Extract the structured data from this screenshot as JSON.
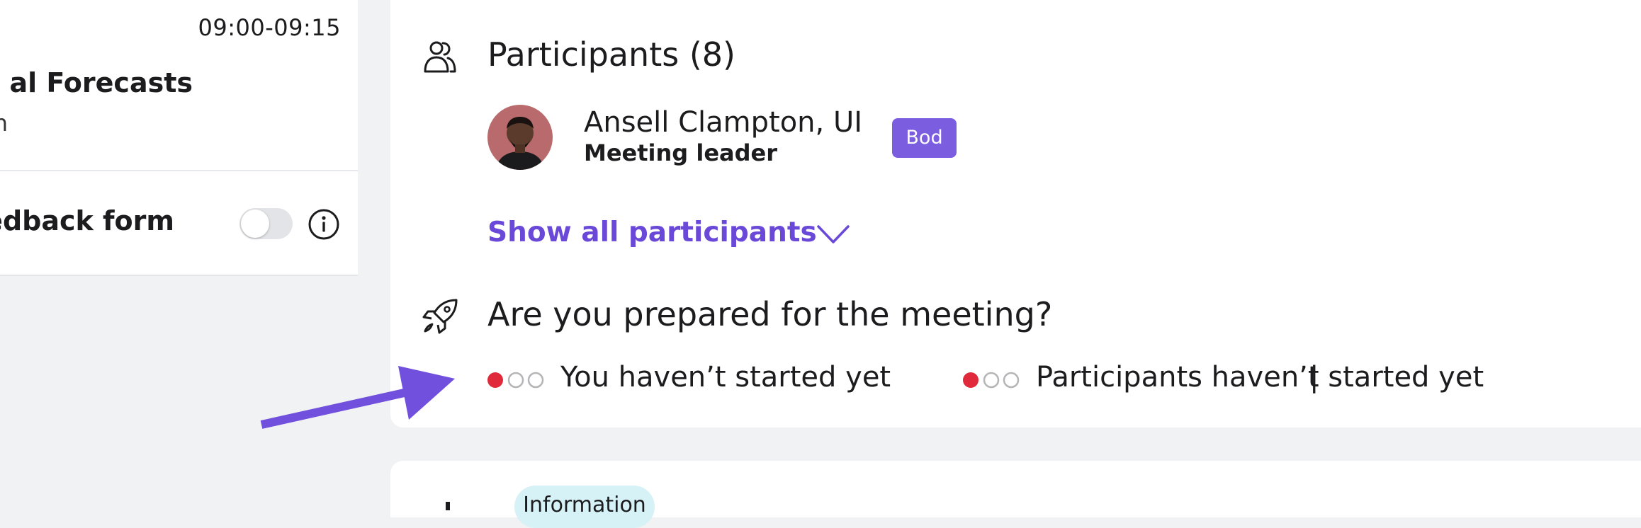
{
  "agenda": {
    "time": "09:00-09:15",
    "title": "al Forecasts",
    "subtitle": "n",
    "feedback_label": "edback form",
    "feedback_enabled": false
  },
  "participants": {
    "title": "Participants (8)",
    "leader_name": "Ansell Clampton, UI",
    "leader_role": "Meeting leader",
    "badge": "Bod",
    "show_all": "Show all participants"
  },
  "preparation": {
    "title": "Are you prepared for the meeting?",
    "you_status": "You haven’t started yet",
    "separator": "|",
    "participants_status": "Participants haven’t started yet"
  },
  "bottom": {
    "tag": "Information"
  },
  "colors": {
    "accent": "#6a48d8",
    "badge": "#7b5ee0",
    "status_red": "#e0293a",
    "info_tag": "#d6f2f7",
    "arrow": "#7050dc"
  }
}
